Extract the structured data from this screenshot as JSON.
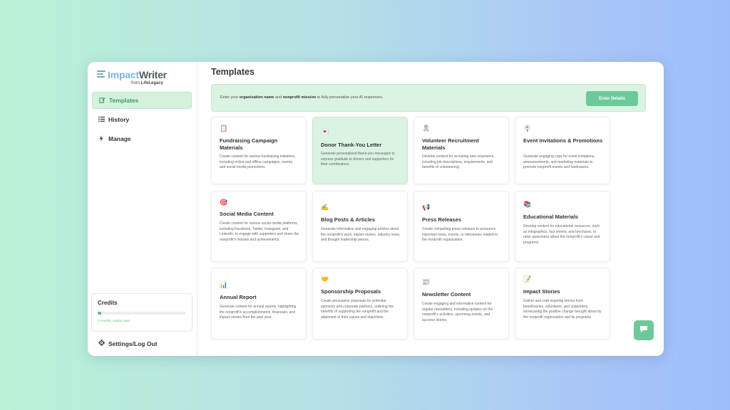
{
  "app": {
    "logo_part1": "Impact",
    "logo_part2": "Writer",
    "logo_sub_prefix": "from",
    "logo_sub_brand": "LifeLegacy"
  },
  "sidebar": {
    "items": [
      {
        "label": "Templates",
        "icon": "edit-icon",
        "active": true
      },
      {
        "label": "History",
        "icon": "list-icon",
        "active": false
      },
      {
        "label": "Manage",
        "icon": "bolt-icon",
        "active": false
      }
    ],
    "credits": {
      "title": "Credits",
      "used_label": "0 monthly credits used",
      "progress": 0.04
    },
    "settings_label": "Settings/Log Out"
  },
  "main": {
    "title": "Templates",
    "banner": {
      "text_before": "Enter your ",
      "bold1": "organization name",
      "text_mid": " and ",
      "bold2": "nonprofit mission",
      "text_after": " to fully personalize your AI responses.",
      "button_label": "Enter Details"
    },
    "cards": [
      {
        "icon": "📋",
        "title": "Fundraising Campaign Materials",
        "desc": "Create content for various fundraising initiatives, including online and offline campaigns, events, and social media promotions."
      },
      {
        "icon": "💌",
        "title": "Donor Thank-You Letter",
        "desc": "Generate personalized thank-you messages to express gratitude to donors and supporters for their contributions."
      },
      {
        "icon": "🎗",
        "title": "Volunteer Recruitment Materials",
        "desc": "Develop content for recruiting new volunteers, including job descriptions, requirements, and benefits of volunteering."
      },
      {
        "icon": "🪧",
        "title": "Event Invitations & Promotions",
        "desc": "Generate engaging copy for event invitations, announcements, and marketing materials to promote nonprofit events and fundraisers."
      },
      {
        "icon": "🎯",
        "title": "Social Media Content",
        "desc": "Create content for various social media platforms, including Facebook, Twitter, Instagram, and LinkedIn, to engage with supporters and share the nonprofit's mission and achievements."
      },
      {
        "icon": "✍",
        "title": "Blog Posts & Articles",
        "desc": "Generate informative and engaging articles about the nonprofit's work, impact stories, industry news, and thought leadership pieces."
      },
      {
        "icon": "📢",
        "title": "Press Releases",
        "desc": "Create compelling press releases to announce important news, events, or milestones related to the nonprofit organization."
      },
      {
        "icon": "📚",
        "title": "Educational Materials",
        "desc": "Develop content for educational resources, such as infographics, fact sheets, and brochures, to raise awareness about the nonprofit's cause and programs."
      },
      {
        "icon": "📊",
        "title": "Annual Report",
        "desc": "Generate content for annual reports, highlighting the nonprofit's accomplishments, financials, and impact stories from the past year."
      },
      {
        "icon": "🤝",
        "title": "Sponsorship Proposals",
        "desc": "Create persuasive proposals for potential sponsors and corporate partners, outlining the benefits of supporting the nonprofit and the alignment of their values and objectives."
      },
      {
        "icon": "📰",
        "title": "Newsletter Content",
        "desc": "Create engaging and informative content for regular newsletters, including updates on the nonprofit's activities, upcoming events, and success stories."
      },
      {
        "icon": "📝",
        "title": "Impact Stories",
        "desc": "Gather and craft inspiring stories from beneficiaries, volunteers, and supporters, showcasing the positive change brought about by the nonprofit organization and its programs."
      }
    ]
  },
  "colors": {
    "accent": "#6ec99a",
    "active_bg": "#daf3e3",
    "active_text": "#3e9c64"
  }
}
